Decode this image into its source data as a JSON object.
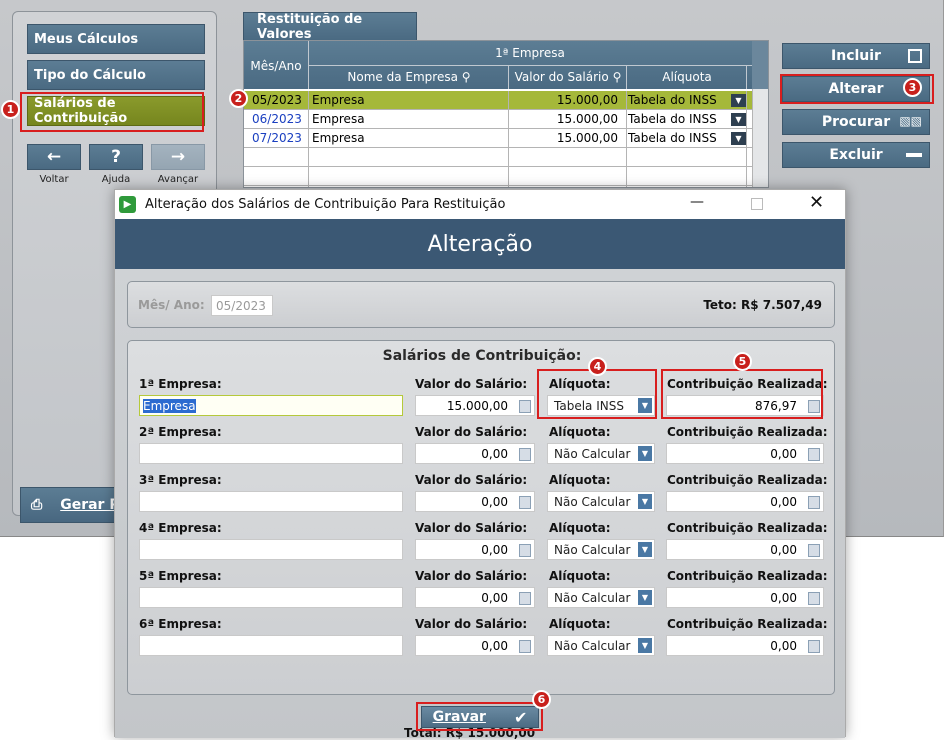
{
  "sidebar": {
    "items": [
      {
        "label": "Meus Cálculos"
      },
      {
        "label": "Tipo do Cálculo"
      },
      {
        "label": "Salários de Contribuição"
      }
    ],
    "nav": {
      "back_label": "Voltar",
      "help_label": "Ajuda",
      "next_label": "Avançar"
    },
    "gerar_label": "Gerar P"
  },
  "tab": {
    "label": "Restituição de Valores"
  },
  "grid": {
    "col_mes": "Mês/Ano",
    "group": "1ª Empresa",
    "col_nome": "Nome da Empresa",
    "col_valor": "Valor do Salário",
    "col_aliquota": "Alíquota",
    "rows": [
      {
        "mes": "05/2023",
        "empresa": "Empresa",
        "valor": "15.000,00",
        "aliquota": "Tabela do INSS"
      },
      {
        "mes": "06/2023",
        "empresa": "Empresa",
        "valor": "15.000,00",
        "aliquota": "Tabela do INSS"
      },
      {
        "mes": "07/2023",
        "empresa": "Empresa",
        "valor": "15.000,00",
        "aliquota": "Tabela do INSS"
      }
    ]
  },
  "actions": {
    "incluir": "Incluir",
    "alterar": "Alterar",
    "procurar": "Procurar",
    "excluir": "Excluir"
  },
  "badges": [
    "1",
    "2",
    "3",
    "4",
    "5",
    "6"
  ],
  "dialog": {
    "title": "Alteração dos Salários de Contribuição Para Restituição",
    "header": "Alteração",
    "mes_label": "Mês/ Ano:",
    "mes_value": "05/2023",
    "teto": "Teto: R$ 7.507,49",
    "section_title": "Salários de Contribuição:",
    "col_valor": "Valor do Salário:",
    "col_aliquota": "Alíquota:",
    "col_contrib": "Contribuição Realizada:",
    "rows": [
      {
        "label": "1ª Empresa:",
        "empresa": "Empresa",
        "valor": "15.000,00",
        "aliquota": "Tabela INSS",
        "contrib": "876,97"
      },
      {
        "label": "2ª Empresa:",
        "empresa": "",
        "valor": "0,00",
        "aliquota": "Não Calcular",
        "contrib": "0,00"
      },
      {
        "label": "3ª Empresa:",
        "empresa": "",
        "valor": "0,00",
        "aliquota": "Não Calcular",
        "contrib": "0,00"
      },
      {
        "label": "4ª Empresa:",
        "empresa": "",
        "valor": "0,00",
        "aliquota": "Não Calcular",
        "contrib": "0,00"
      },
      {
        "label": "5ª Empresa:",
        "empresa": "",
        "valor": "0,00",
        "aliquota": "Não Calcular",
        "contrib": "0,00"
      },
      {
        "label": "6ª Empresa:",
        "empresa": "",
        "valor": "0,00",
        "aliquota": "Não Calcular",
        "contrib": "0,00"
      }
    ],
    "total": "Total: R$ 15.000,00",
    "gravar_label": "Gravar"
  },
  "colors": {
    "accent": "#4a6a82",
    "active": "#7d8d22",
    "header": "#3b5874",
    "highlight_row": "#a5b83a",
    "callout": "#d81e1e"
  }
}
